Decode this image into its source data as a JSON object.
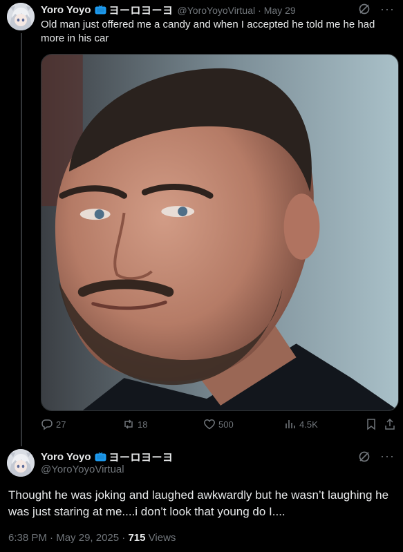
{
  "reply_to": {
    "display_name": "Yoro Yoyo",
    "badge_icon": "tv-icon",
    "name_suffix": "ヨーロヨーヨ",
    "handle": "@YoroYoyoVirtual",
    "separator": "·",
    "date": "May 29",
    "text": "Old man just offered me a candy and when I accepted he told me he had more in his car",
    "stats": {
      "replies": "27",
      "reposts": "18",
      "likes": "500",
      "views": "4.5K"
    }
  },
  "main_post": {
    "display_name": "Yoro Yoyo",
    "badge_icon": "tv-icon",
    "name_suffix": "ヨーロヨーヨ",
    "handle": "@YoroYoyoVirtual",
    "text": "Thought he was joking and laughed awkwardly but he wasn’t laughing he was just staring at me....i don’t look that young do I....",
    "time": "6:38 PM",
    "date": "May 29, 2025",
    "separator": "·",
    "views_count": "715",
    "views_label": "Views"
  },
  "colors": {
    "background": "#000000",
    "text_primary": "#e7e9ea",
    "text_secondary": "#71767b",
    "thread_line": "#333639",
    "badge_blue": "#1d9bf0"
  }
}
